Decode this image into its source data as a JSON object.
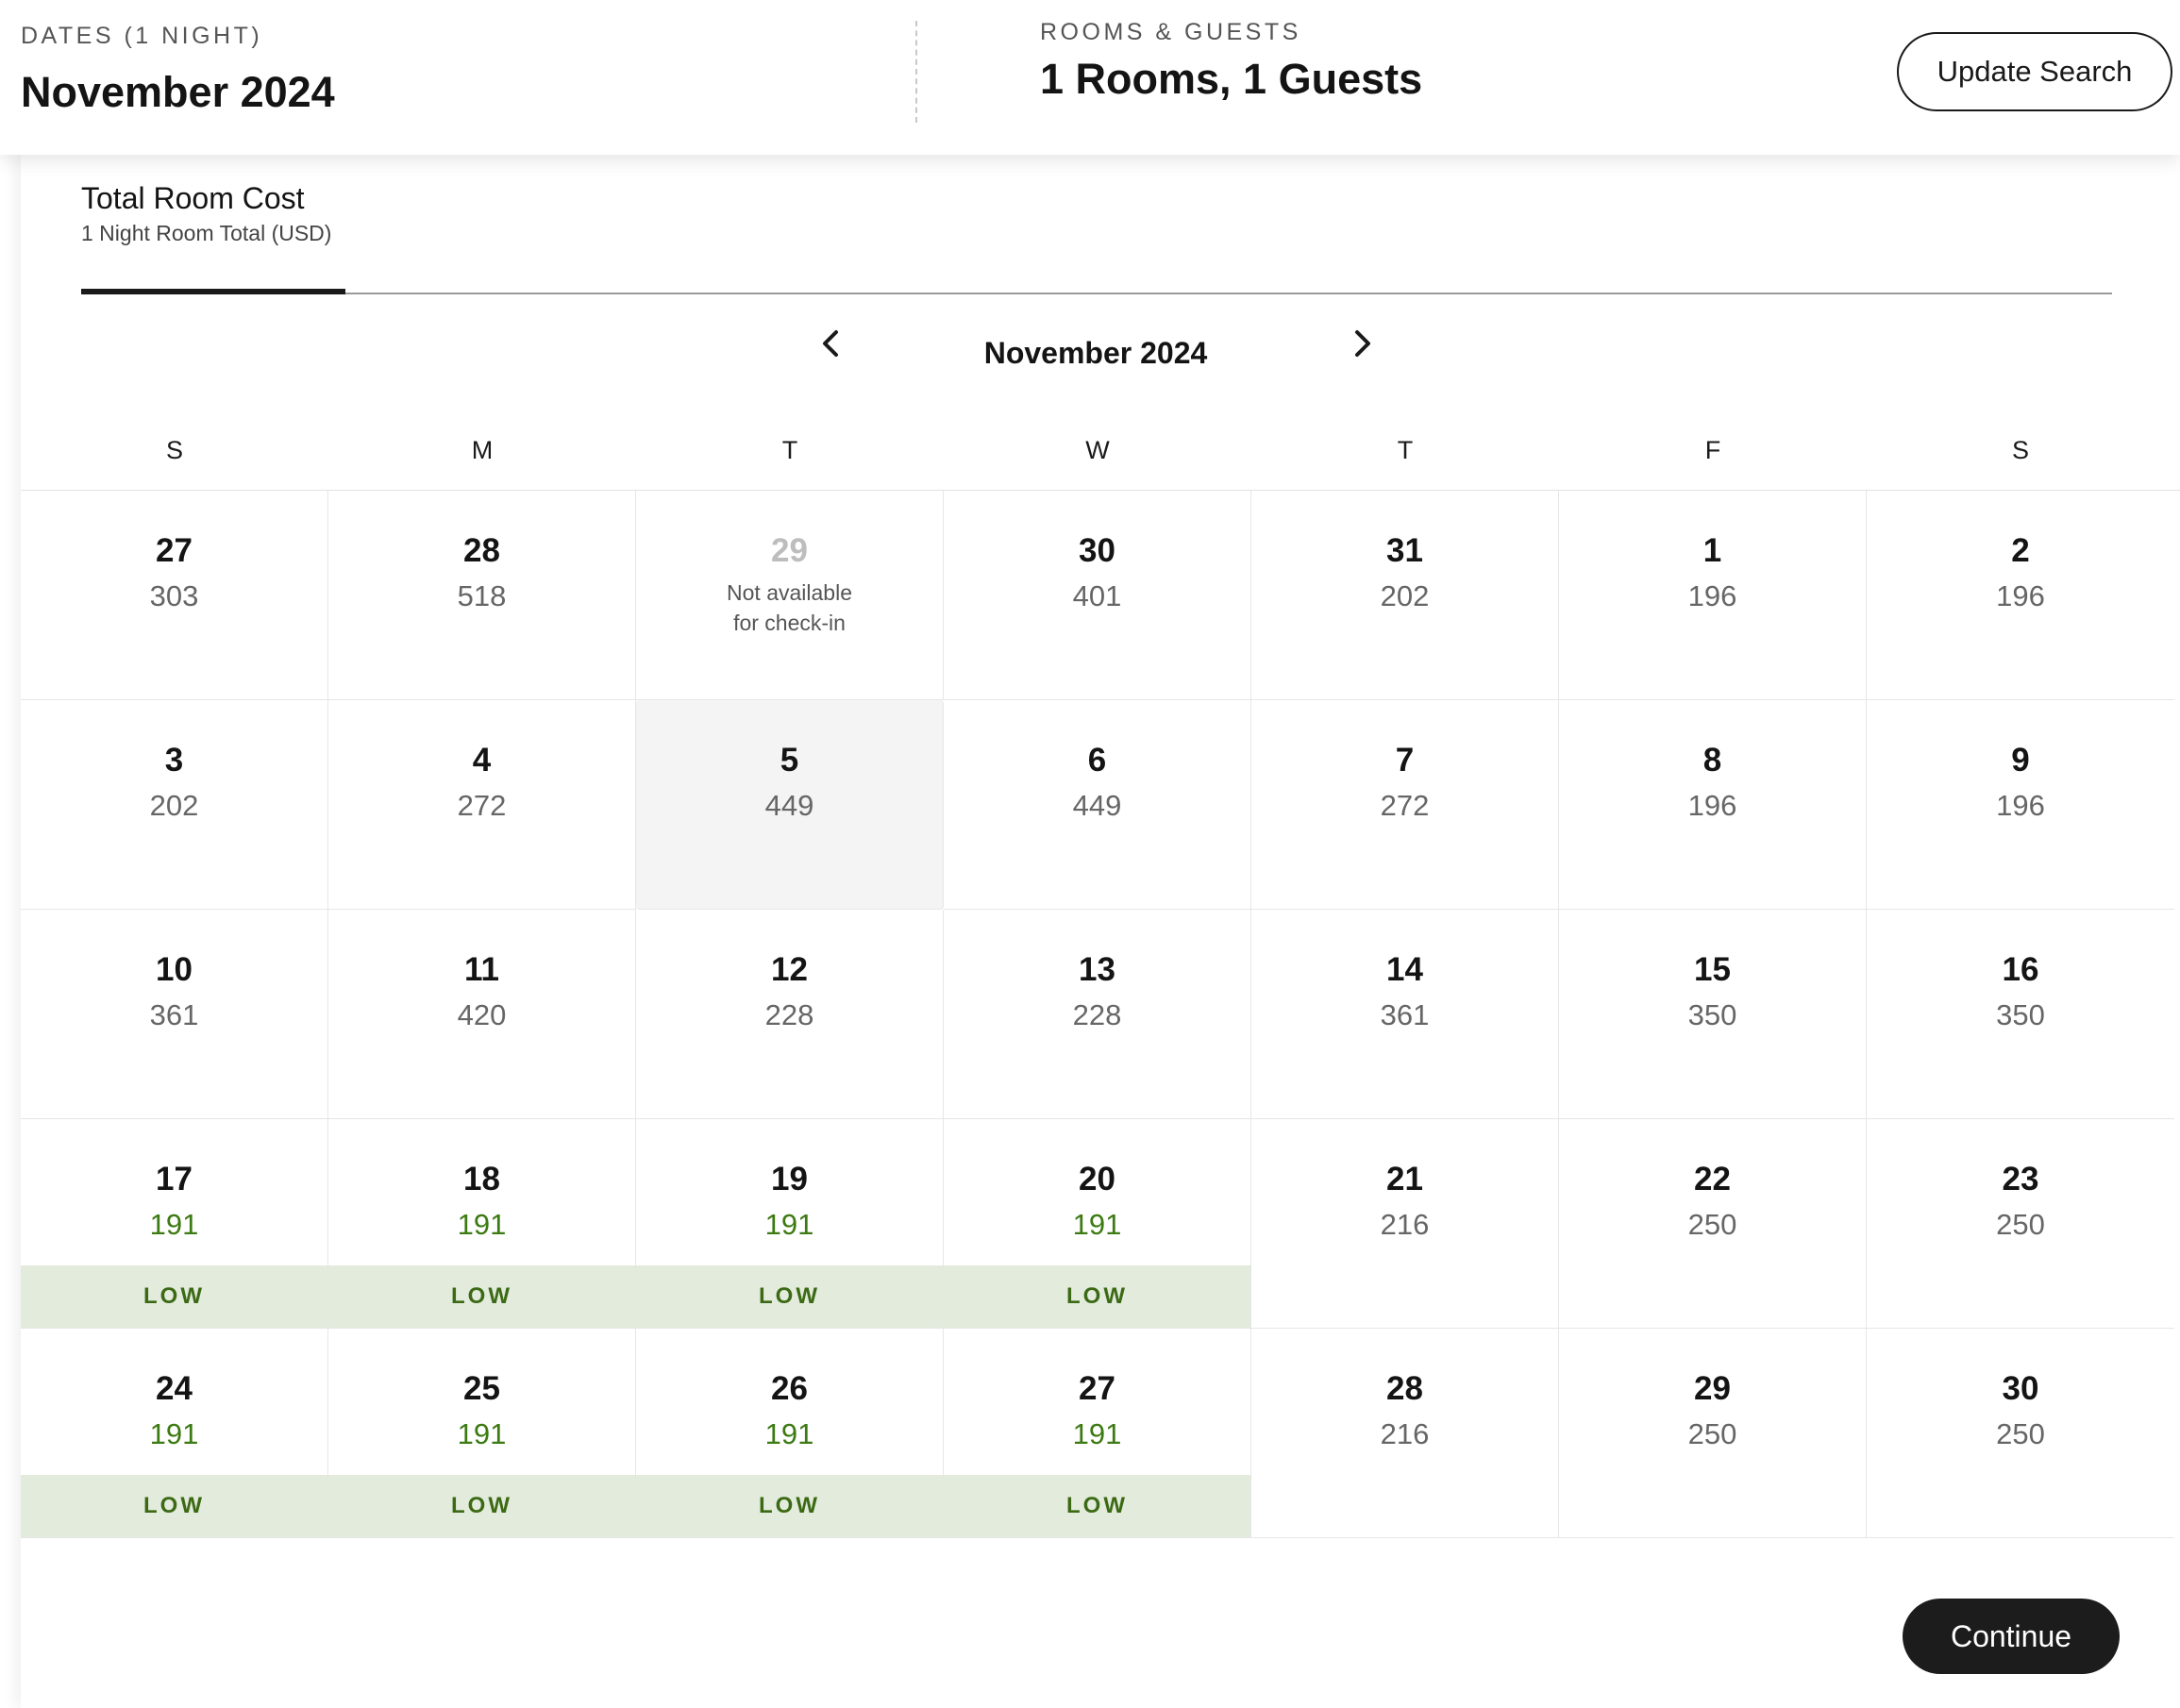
{
  "header": {
    "dates_label": "DATES (1 NIGHT)",
    "dates_value": "November 2024",
    "rooms_label": "ROOMS & GUESTS",
    "rooms_value": "1 Rooms, 1 Guests",
    "update_label": "Update Search"
  },
  "tab": {
    "title": "Total Room Cost",
    "subtitle": "1 Night Room Total (USD)"
  },
  "calendar": {
    "month_label": "November 2024",
    "prev_icon": "chevron-left-icon",
    "next_icon": "chevron-right-icon",
    "weekdays": [
      "S",
      "M",
      "T",
      "W",
      "T",
      "F",
      "S"
    ],
    "low_label": "LOW",
    "low_color": "#3c7a12",
    "days": [
      {
        "day": "27",
        "price": "303"
      },
      {
        "day": "28",
        "price": "518"
      },
      {
        "day": "29",
        "price": "",
        "note": [
          "Not available",
          "for check-in"
        ],
        "unavailable": true
      },
      {
        "day": "30",
        "price": "401"
      },
      {
        "day": "31",
        "price": "202"
      },
      {
        "day": "1",
        "price": "196"
      },
      {
        "day": "2",
        "price": "196"
      },
      {
        "day": "3",
        "price": "202"
      },
      {
        "day": "4",
        "price": "272"
      },
      {
        "day": "5",
        "price": "449",
        "selected": true
      },
      {
        "day": "6",
        "price": "449"
      },
      {
        "day": "7",
        "price": "272"
      },
      {
        "day": "8",
        "price": "196"
      },
      {
        "day": "9",
        "price": "196"
      },
      {
        "day": "10",
        "price": "361"
      },
      {
        "day": "11",
        "price": "420"
      },
      {
        "day": "12",
        "price": "228"
      },
      {
        "day": "13",
        "price": "228"
      },
      {
        "day": "14",
        "price": "361"
      },
      {
        "day": "15",
        "price": "350"
      },
      {
        "day": "16",
        "price": "350"
      },
      {
        "day": "17",
        "price": "191",
        "low": true
      },
      {
        "day": "18",
        "price": "191",
        "low": true
      },
      {
        "day": "19",
        "price": "191",
        "low": true
      },
      {
        "day": "20",
        "price": "191",
        "low": true
      },
      {
        "day": "21",
        "price": "216"
      },
      {
        "day": "22",
        "price": "250"
      },
      {
        "day": "23",
        "price": "250"
      },
      {
        "day": "24",
        "price": "191",
        "low": true
      },
      {
        "day": "25",
        "price": "191",
        "low": true
      },
      {
        "day": "26",
        "price": "191",
        "low": true
      },
      {
        "day": "27",
        "price": "191",
        "low": true
      },
      {
        "day": "28",
        "price": "216"
      },
      {
        "day": "29",
        "price": "250"
      },
      {
        "day": "30",
        "price": "250"
      }
    ]
  },
  "footer": {
    "continue_label": "Continue"
  }
}
